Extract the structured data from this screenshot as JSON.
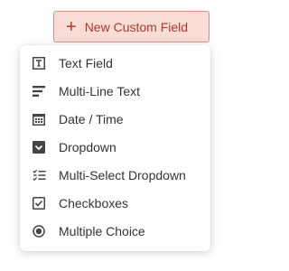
{
  "header": {
    "new_field_label": "New Custom Field",
    "plus_glyph": "+"
  },
  "menu": {
    "items": [
      {
        "label": "Text Field",
        "icon": "text-field-icon"
      },
      {
        "label": "Multi-Line Text",
        "icon": "multi-line-text-icon"
      },
      {
        "label": "Date / Time",
        "icon": "calendar-icon"
      },
      {
        "label": "Dropdown",
        "icon": "dropdown-icon"
      },
      {
        "label": "Multi-Select Dropdown",
        "icon": "multi-select-icon"
      },
      {
        "label": "Checkboxes",
        "icon": "checkbox-icon"
      },
      {
        "label": "Multiple Choice",
        "icon": "radio-icon"
      }
    ]
  },
  "colors": {
    "accent": "#b3382c",
    "button_bg": "#f7ddd6",
    "icon": "#444444",
    "text": "#333333"
  }
}
